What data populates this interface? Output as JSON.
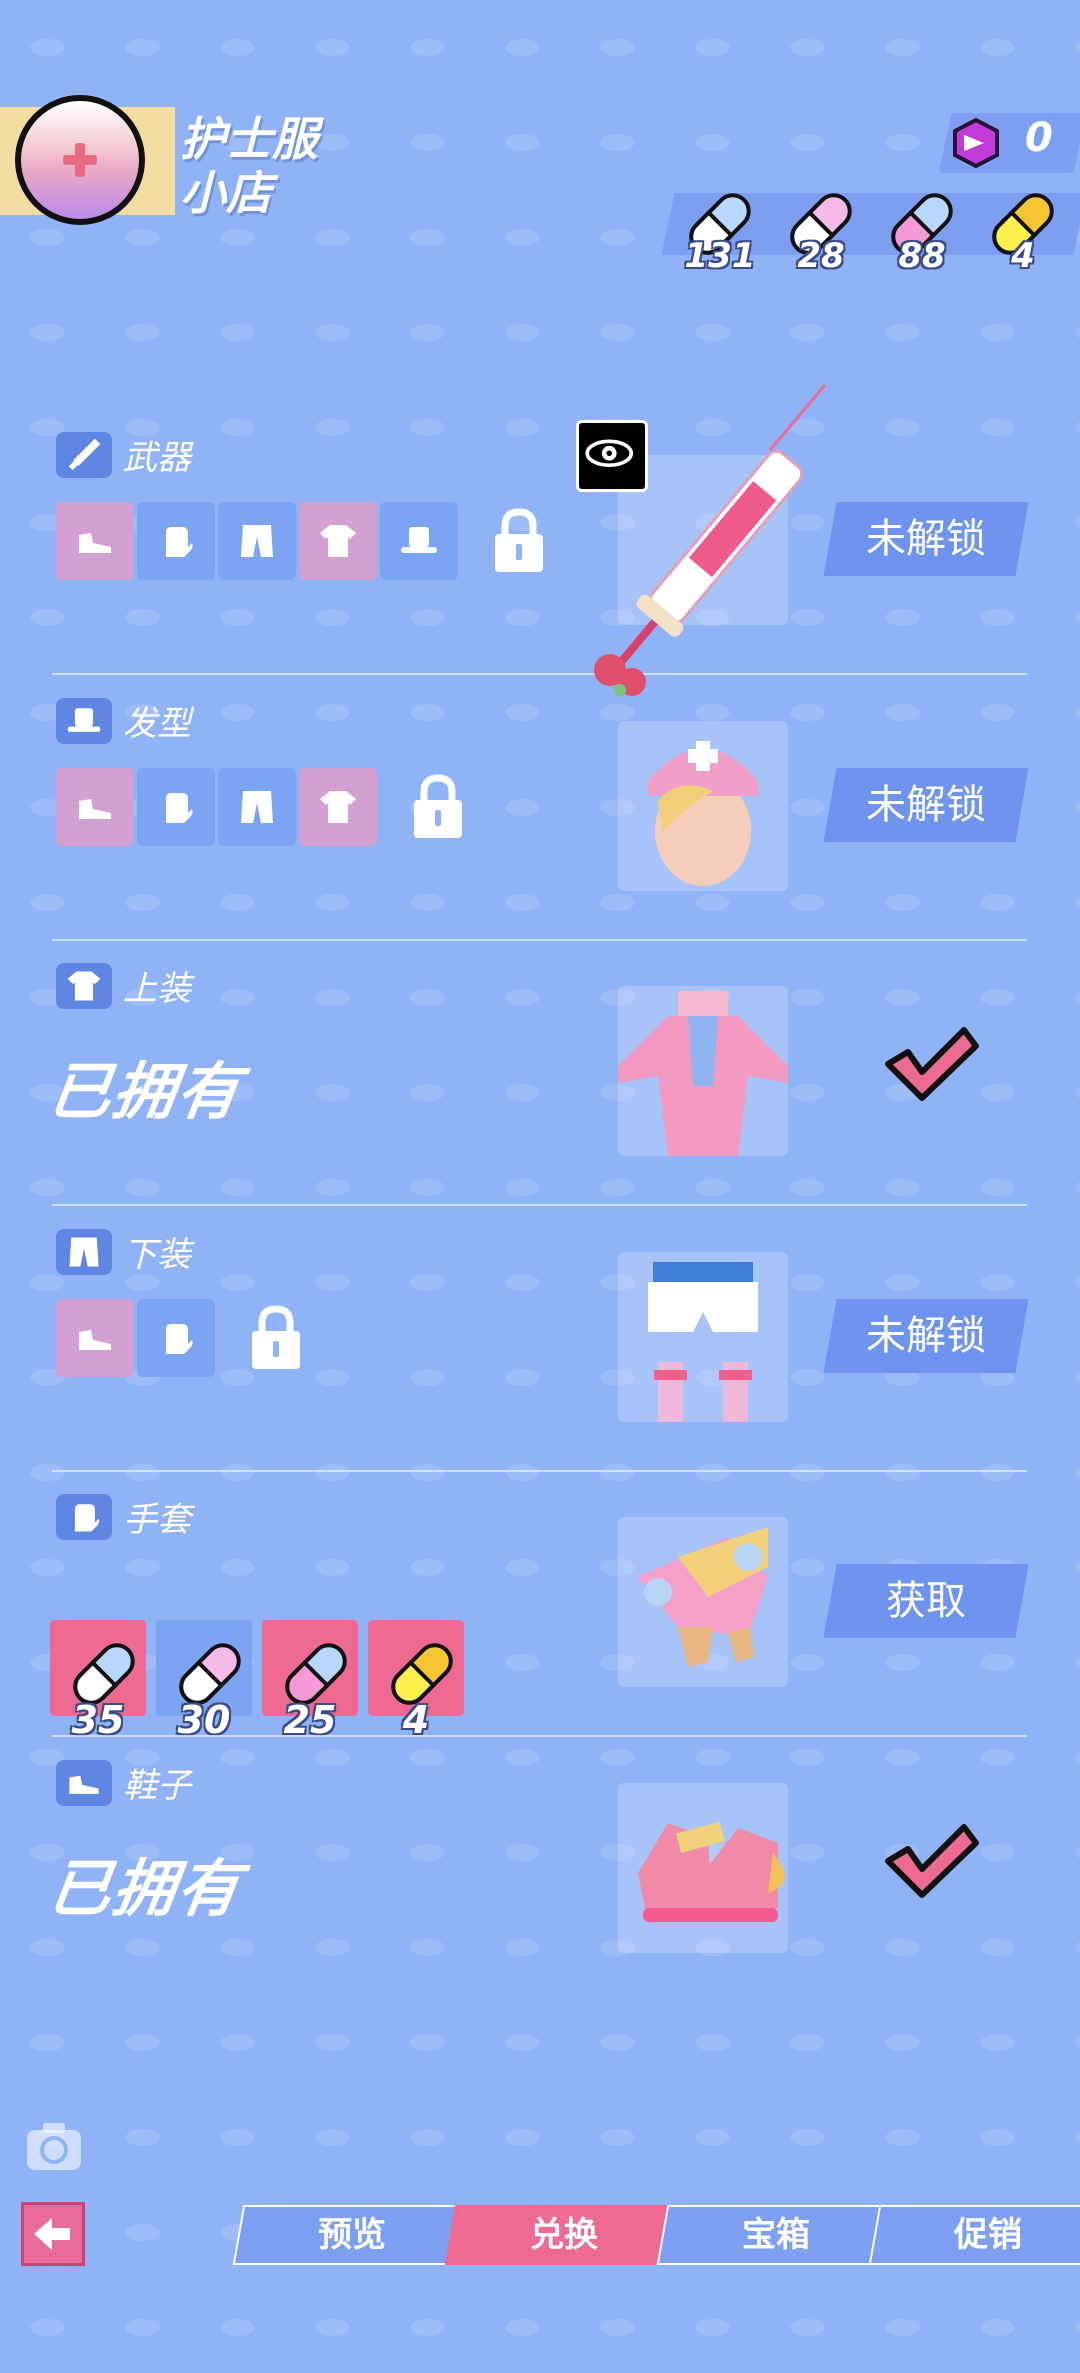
{
  "header": {
    "shop_title": "护士服\n小店",
    "gem_count": "0",
    "pills": [
      {
        "color": "blue",
        "count": "131"
      },
      {
        "color": "pink",
        "count": "28"
      },
      {
        "color": "pinkblue",
        "count": "88"
      },
      {
        "color": "yellow",
        "count": "4"
      }
    ]
  },
  "items": [
    {
      "category": "武器",
      "icon": "sword-icon",
      "status": "未解锁",
      "state": "locked",
      "requirements": [
        "shoe-icon",
        "glove-icon",
        "pants-icon",
        "shirt-icon",
        "hat-icon"
      ]
    },
    {
      "category": "发型",
      "icon": "hat-icon",
      "status": "未解锁",
      "state": "locked",
      "requirements": [
        "shoe-icon",
        "glove-icon",
        "pants-icon",
        "shirt-icon"
      ]
    },
    {
      "category": "上装",
      "icon": "shirt-icon",
      "status": "已拥有",
      "state": "owned"
    },
    {
      "category": "下装",
      "icon": "pants-icon",
      "status": "未解锁",
      "state": "locked",
      "requirements": [
        "shoe-icon",
        "glove-icon"
      ]
    },
    {
      "category": "手套",
      "icon": "glove-icon",
      "status": "获取",
      "state": "buy",
      "costs": [
        {
          "color": "blue",
          "amount": "35"
        },
        {
          "color": "pink",
          "amount": "30"
        },
        {
          "color": "pinkblue",
          "amount": "25"
        },
        {
          "color": "yellow",
          "amount": "4"
        }
      ]
    },
    {
      "category": "鞋子",
      "icon": "shoe-icon",
      "status": "已拥有",
      "state": "owned"
    }
  ],
  "tabs": [
    {
      "label": "预览"
    },
    {
      "label": "兑换",
      "active": true
    },
    {
      "label": "宝箱"
    },
    {
      "label": "促销"
    }
  ],
  "colors": {
    "background": "#90b3f7",
    "accent_pink": "#ef6a93",
    "button_blue": "#6f94ef"
  }
}
